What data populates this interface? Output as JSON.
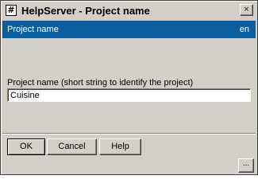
{
  "window": {
    "title": "HelpServer - Project name",
    "icon_glyph": "#",
    "close_glyph": "×"
  },
  "header": {
    "title": "Project name",
    "language": "en",
    "band_color": "#0a5fa1"
  },
  "form": {
    "label": "Project name (short string to identify the project)",
    "value": "Cuisine"
  },
  "buttons": {
    "ok": "OK",
    "cancel": "Cancel",
    "help": "Help"
  },
  "status": {
    "more_glyph": "..."
  }
}
